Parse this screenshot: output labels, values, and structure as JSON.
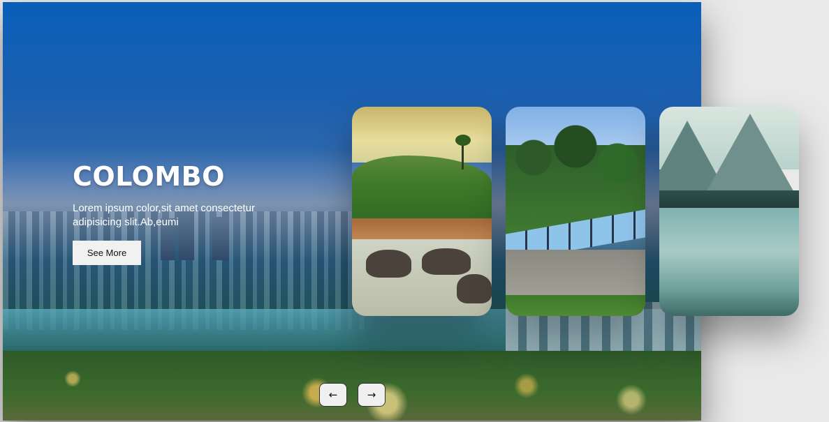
{
  "hero": {
    "title": "COLOMBO",
    "description": "Lorem ipsum color,sit amet consectetur adipisicing slit.Ab,eumi",
    "button_label": "See More"
  },
  "cards": [
    {
      "name": "elephants-river"
    },
    {
      "name": "train-bridge"
    },
    {
      "name": "mountain-lake"
    }
  ],
  "navigation": {
    "prev_icon": "arrow-left-icon",
    "prev_glyph": "←",
    "next_icon": "arrow-right-icon",
    "next_glyph": "→"
  }
}
